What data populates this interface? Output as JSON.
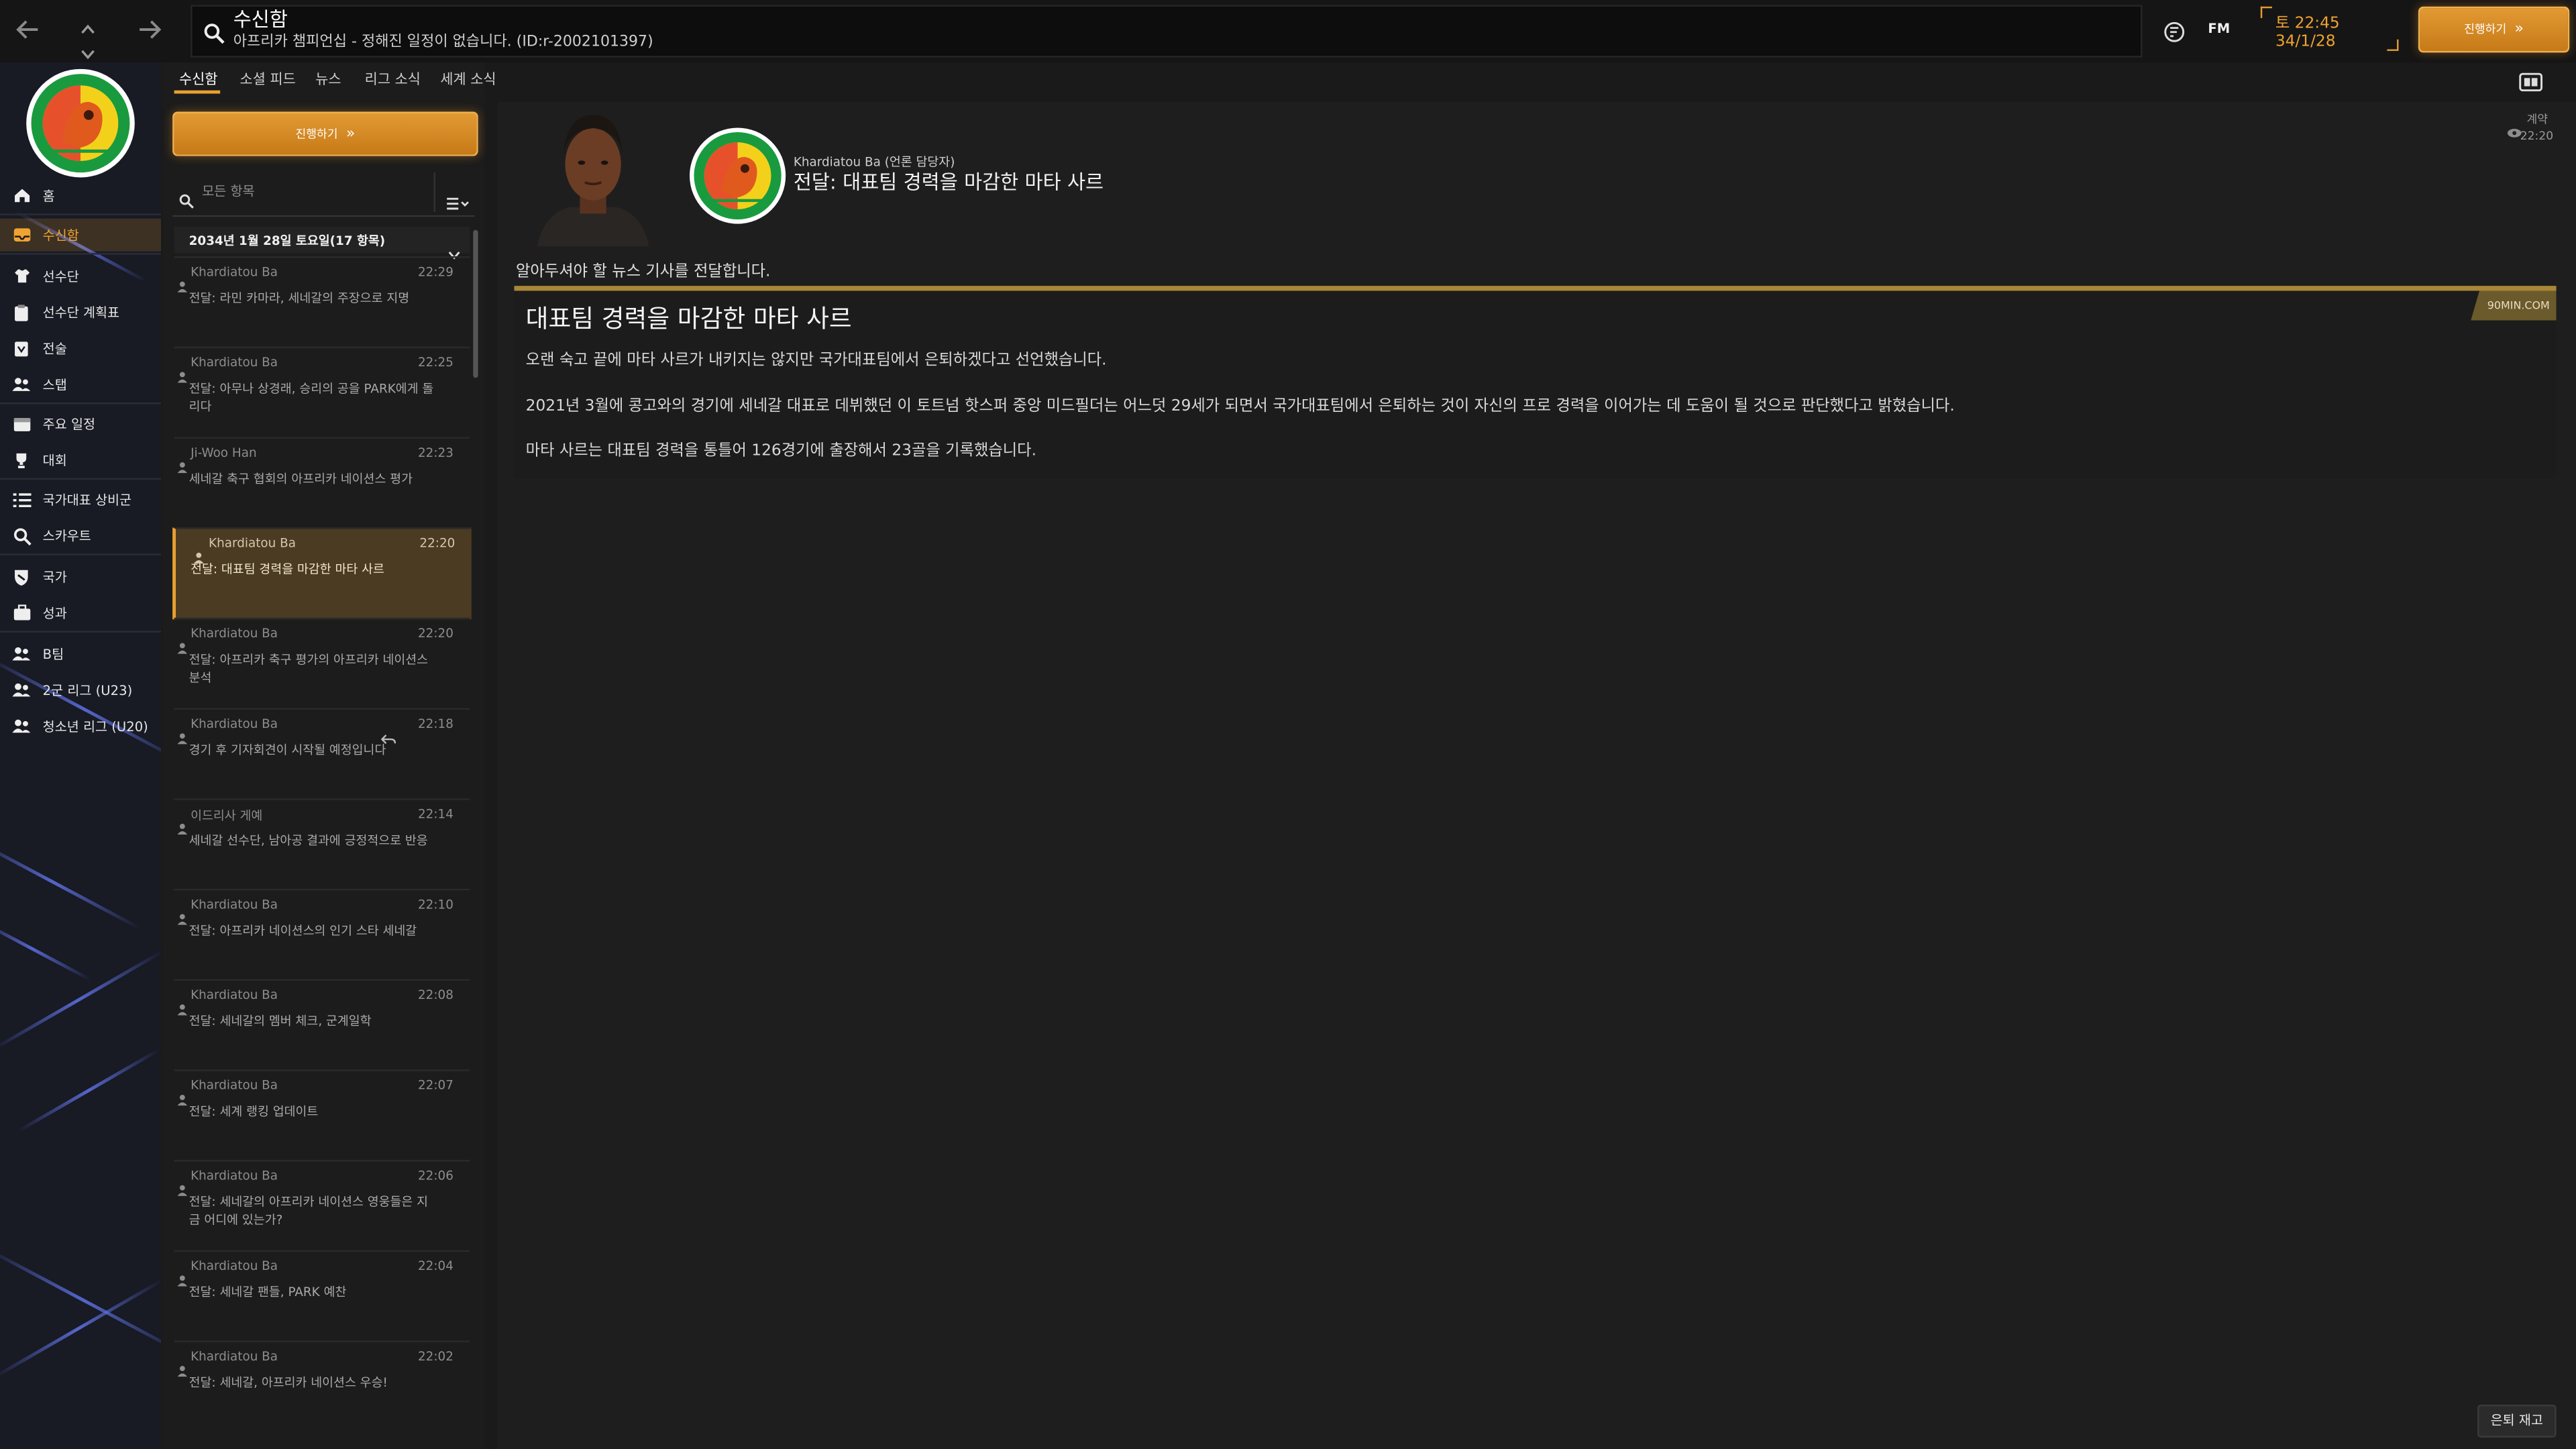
{
  "topbar": {
    "title": "수신함",
    "subtitle": "아프리카 챔피언십 - 정해진 일정이 없습니다. (ID:r-2002101397)",
    "brand": "FM",
    "day_time": "토 22:45",
    "date": "34/1/28",
    "continue_label": "진행하기"
  },
  "tabs": [
    "수신함",
    "소셜 피드",
    "뉴스",
    "리그 소식",
    "세계 소식"
  ],
  "sidebar": {
    "items": [
      {
        "label": "홈",
        "icon": "home-icon"
      },
      {
        "label": "수신함",
        "icon": "inbox-icon"
      },
      {
        "label": "선수단",
        "icon": "jersey-icon"
      },
      {
        "label": "선수단 계획표",
        "icon": "clipboard-icon"
      },
      {
        "label": "전술",
        "icon": "tactics-icon"
      },
      {
        "label": "스탭",
        "icon": "staff-icon"
      },
      {
        "label": "주요 일정",
        "icon": "calendar-icon"
      },
      {
        "label": "대회",
        "icon": "trophy-icon"
      },
      {
        "label": "국가대표 상비군",
        "icon": "list-icon"
      },
      {
        "label": "스카우트",
        "icon": "scout-icon"
      },
      {
        "label": "국가",
        "icon": "nation-shield-icon"
      },
      {
        "label": "성과",
        "icon": "briefcase-icon"
      },
      {
        "label": "B팀",
        "icon": "team-icon"
      },
      {
        "label": "2군 리그 (U23)",
        "icon": "team-icon"
      },
      {
        "label": "청소년 리그 (U20)",
        "icon": "team-icon"
      }
    ]
  },
  "list": {
    "continue_label": "진행하기",
    "search_placeholder": "모든 항목",
    "date_header": "2034년 1월 28일 토요일(17 항목)",
    "messages": [
      {
        "sender": "Khardiatou Ba",
        "time": "22:29",
        "subject": "전달: 라민 카마라, 세네갈의 주장으로 지명"
      },
      {
        "sender": "Khardiatou Ba",
        "time": "22:25",
        "subject": "전달: 아무나 상경래, 승리의 공을 PARK에게 돌리다"
      },
      {
        "sender": "Ji-Woo Han",
        "time": "22:23",
        "subject": "세네갈 축구 협회의 아프리카 네이션스 평가"
      },
      {
        "sender": "Khardiatou Ba",
        "time": "22:20",
        "subject": "전달: 대표팀 경력을 마감한 마타 사르"
      },
      {
        "sender": "Khardiatou Ba",
        "time": "22:20",
        "subject": "전달: 아프리카 축구 평가의 아프리카 네이션스 분석"
      },
      {
        "sender": "Khardiatou Ba",
        "time": "22:18",
        "subject": "경기 후 기자회견이 시작될 예정입니다"
      },
      {
        "sender": "이드리사 게예",
        "time": "22:14",
        "subject": "세네갈 선수단, 남아공 결과에 긍정적으로 반응"
      },
      {
        "sender": "Khardiatou Ba",
        "time": "22:10",
        "subject": "전달: 아프리카 네이션스의 인기 스타 세네갈"
      },
      {
        "sender": "Khardiatou Ba",
        "time": "22:08",
        "subject": "전달: 세네갈의 멤버 체크, 군계일학"
      },
      {
        "sender": "Khardiatou Ba",
        "time": "22:07",
        "subject": "전달: 세계 랭킹 업데이트"
      },
      {
        "sender": "Khardiatou Ba",
        "time": "22:06",
        "subject": "전달: 세네갈의 아프리카 네이션스 영웅들은 지금 어디에 있는가?"
      },
      {
        "sender": "Khardiatou Ba",
        "time": "22:04",
        "subject": "전달: 세네갈 팬들, PARK 예찬"
      },
      {
        "sender": "Khardiatou Ba",
        "time": "22:02",
        "subject": "전달: 세네갈, 아프리카 네이션스 우승!"
      }
    ]
  },
  "article": {
    "from": "Khardiatou Ba",
    "from_role": "(언론 담당자)",
    "header_title": "전달: 대표팀 경력을 마감한 마타 사르",
    "meta_label": "계약",
    "meta_time": "22:20",
    "intro": "알아두셔야 할 뉴스 기사를 전달합니다.",
    "source": "90MIN.COM",
    "headline": "대표팀 경력을 마감한 마타 사르",
    "paragraphs": [
      "오랜 숙고 끝에 마타 사르가 내키지는 않지만 국가대표팀에서 은퇴하겠다고 선언했습니다.",
      "2021년 3월에 콩고와의 경기에 세네갈 대표로 데뷔했던 이 토트넘 핫스퍼 중앙 미드필더는 어느덧 29세가 되면서 국가대표팀에서 은퇴하는 것이 자신의 프로 경력을 이어가는 데 도움이 될 것으로 판단했다고 밝혔습니다.",
      "마타 사르는 대표팀 경력을 통틀어 126경기에 출장해서 23골을 기록했습니다."
    ],
    "footer_button": "은퇴 재고"
  }
}
